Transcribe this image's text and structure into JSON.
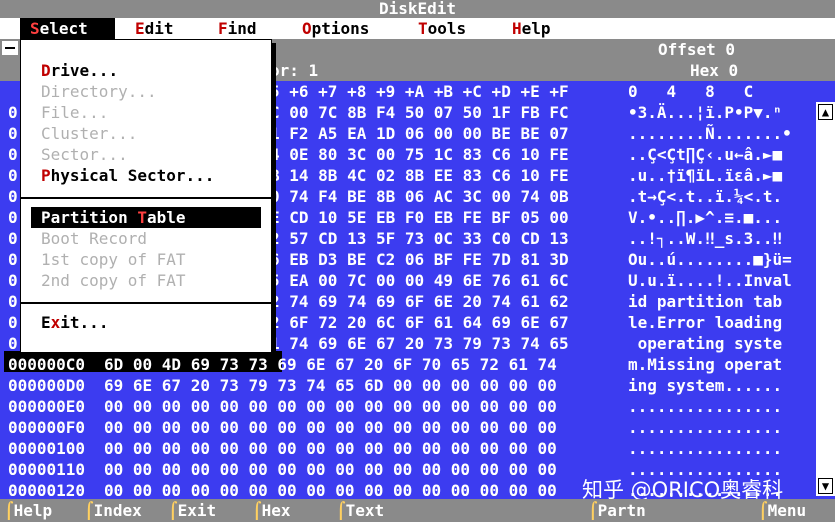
{
  "title": "DiskEdit",
  "menu": {
    "select": {
      "hk": "S",
      "rest": "elect"
    },
    "edit": {
      "hk": "E",
      "rest": "dit"
    },
    "find": {
      "hk": "F",
      "rest": "ind"
    },
    "options": {
      "hk": "O",
      "rest": "ptions"
    },
    "tools": {
      "hk": "T",
      "rest": "ools"
    },
    "help": {
      "hk": "H",
      "rest": "elp"
    }
  },
  "header": {
    "offset": "Offset 0",
    "hex": "Hex 0",
    "frag1": "or: 1",
    "colheads": "5 +6 +7 +8 +9 +A +B +C +D +E +F",
    "textheads": "0   4   8   C"
  },
  "dropdown": {
    "drive": {
      "pre": "",
      "hk": "D",
      "post": "rive..."
    },
    "directory": "Directory...",
    "file": "File...",
    "cluster": "Cluster...",
    "sector": "Sector...",
    "physical": {
      "pre": "",
      "hk": "P",
      "post": "hysical Sector..."
    },
    "partition": {
      "pre": "Partition ",
      "hk": "T",
      "post": "able"
    },
    "boot": "Boot Record",
    "fat1": "1st copy of FAT",
    "fat2": "2nd copy of FAT",
    "exit": {
      "pre": "E",
      "hk": "x",
      "post": "it..."
    }
  },
  "rows": [
    {
      "off": "0",
      "hex": "C 00 7C 8B F4 50 07 50 1F FB FC",
      "text": "•3.Ä...¦ï.P•P▼.ⁿ"
    },
    {
      "off": "0",
      "hex": "1 F2 A5 EA 1D 06 00 00 BE BE 07",
      "text": "........Ñ.......•"
    },
    {
      "off": "0",
      "hex": "4 0E 80 3C 00 75 1C 83 C6 10 FE",
      "text": "..Ç<Çt∏Ç‹.u←â.►■"
    },
    {
      "off": "0",
      "hex": "B 14 8B 4C 02 8B EE 83 C6 10 FE",
      "text": ".u..†ï¶ïL.ïεâ.►■"
    },
    {
      "off": "0",
      "hex": "0 74 F4 BE 8B 06 AC 3C 00 74 0B",
      "text": ".t→Ç<.t..ï.¼<.t."
    },
    {
      "off": "0",
      "hex": "E CD 10 5E EB F0 EB FE BF 05 00",
      "text": "V.•..∏.▶^.≡.■..."
    },
    {
      "off": "0",
      "hex": "2 57 CD 13 5F 73 0C 33 C0 CD 13",
      "text": "..!┐..W.‼_s.3..‼"
    },
    {
      "off": "0",
      "hex": "6 EB D3 BE C2 06 BF FE 7D 81 3D",
      "text": "Ou..ú........■}ü="
    },
    {
      "off": "0",
      "hex": "5 EA 00 7C 00 00 49 6E 76 61 6C",
      "text": "U.u.ï....!..Inval"
    },
    {
      "off": "0",
      "hex": "2 74 69 74 69 6F 6E 20 74 61 62",
      "text": "id partition tab"
    },
    {
      "off": "0",
      "hex": "2 6F 72 20 6C 6F 61 64 69 6E 67",
      "text": "le.Error loading"
    },
    {
      "off": "0",
      "hex": "1 74 69 6E 67 20 73 79 73 74 65",
      "text": " operating syste"
    },
    {
      "off": "000000C0",
      "hex": "6D 00 4D 69 73 73 69 6E 67 20 6F 70 65 72 61 74",
      "text": "m.Missing operat"
    },
    {
      "off": "000000D0",
      "hex": "69 6E 67 20 73 79 73 74 65 6D 00 00 00 00 00 00",
      "text": "ing system......"
    },
    {
      "off": "000000E0",
      "hex": "00 00 00 00 00 00 00 00 00 00 00 00 00 00 00 00",
      "text": "................"
    },
    {
      "off": "000000F0",
      "hex": "00 00 00 00 00 00 00 00 00 00 00 00 00 00 00 00",
      "text": "................"
    },
    {
      "off": "00000100",
      "hex": "00 00 00 00 00 00 00 00 00 00 00 00 00 00 00 00",
      "text": "................"
    },
    {
      "off": "00000110",
      "hex": "00 00 00 00 00 00 00 00 00 00 00 00 00 00 00 00",
      "text": "................"
    },
    {
      "off": "00000120",
      "hex": "00 00 00 00 00 00 00 00 00 00 00 00 00 00 00 00",
      "text": "................"
    }
  ],
  "status": [
    {
      "key": "F1",
      "label": "Help"
    },
    {
      "key": "F2",
      "label": "Index"
    },
    {
      "key": "F3",
      "label": "Exit"
    },
    {
      "key": "F4",
      "label": "Hex"
    },
    {
      "key": "F5",
      "label": "Text"
    },
    {
      "key": "F6",
      "label": "Partn"
    },
    {
      "key": "F10",
      "label": "Menu"
    }
  ],
  "watermark": "知乎 @ORICO奥睿科"
}
